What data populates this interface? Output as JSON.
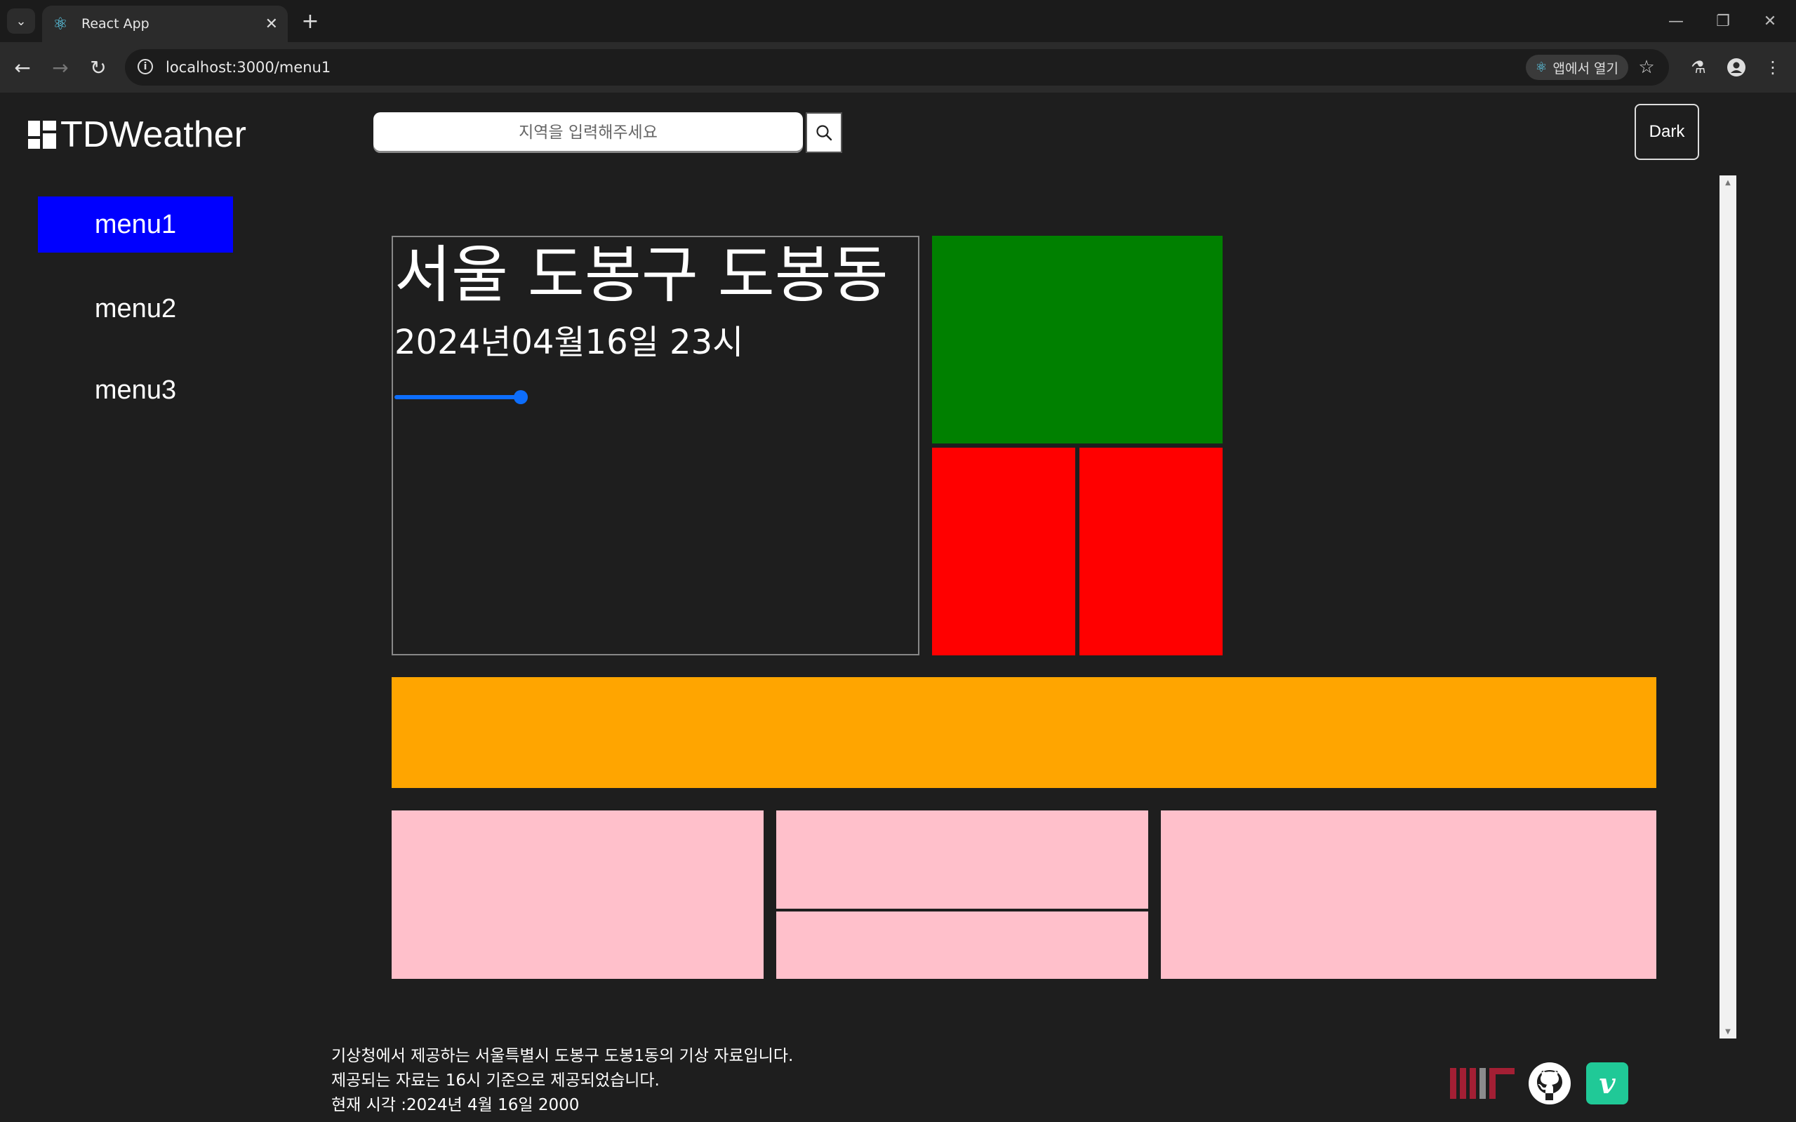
{
  "browser": {
    "tab_title": "React App",
    "url": "localhost:3000/menu1",
    "open_in_app_label": "앱에서 열기",
    "icons": [
      "tab-list-icon",
      "react-favicon-icon",
      "close-icon",
      "plus-icon",
      "back-icon",
      "forward-icon",
      "reload-icon",
      "info-icon",
      "star-icon",
      "labs-icon",
      "profile-icon",
      "more-icon"
    ]
  },
  "app": {
    "logo_text": "TDWeather",
    "search_placeholder": "지역을 입력해주세요",
    "theme_button_label": "Dark",
    "menu": [
      {
        "label": "menu1",
        "active": true
      },
      {
        "label": "menu2",
        "active": false
      },
      {
        "label": "menu3",
        "active": false
      }
    ],
    "weather": {
      "location": "서울 도봉구 도봉동",
      "datetime": "2024년04월16일 23시"
    },
    "footer": {
      "line1": "기상청에서 제공하는 서울특별시 도봉구 도봉1동의 기상 자료입니다.",
      "line2": "제공되는 자료는 16시 기준으로 제공되었습니다.",
      "line3": "현재 시각 :2024년 4월 16일 2000"
    },
    "footer_icons": [
      "mit-icon",
      "github-icon",
      "vimeo-icon"
    ],
    "colors": {
      "active_menu": "#0000ff",
      "green_panel": "#008000",
      "red_panel": "#ff0000",
      "orange_panel": "#ffa500",
      "pink_panel": "#ffc0cb",
      "background": "#1e1e1e"
    }
  }
}
